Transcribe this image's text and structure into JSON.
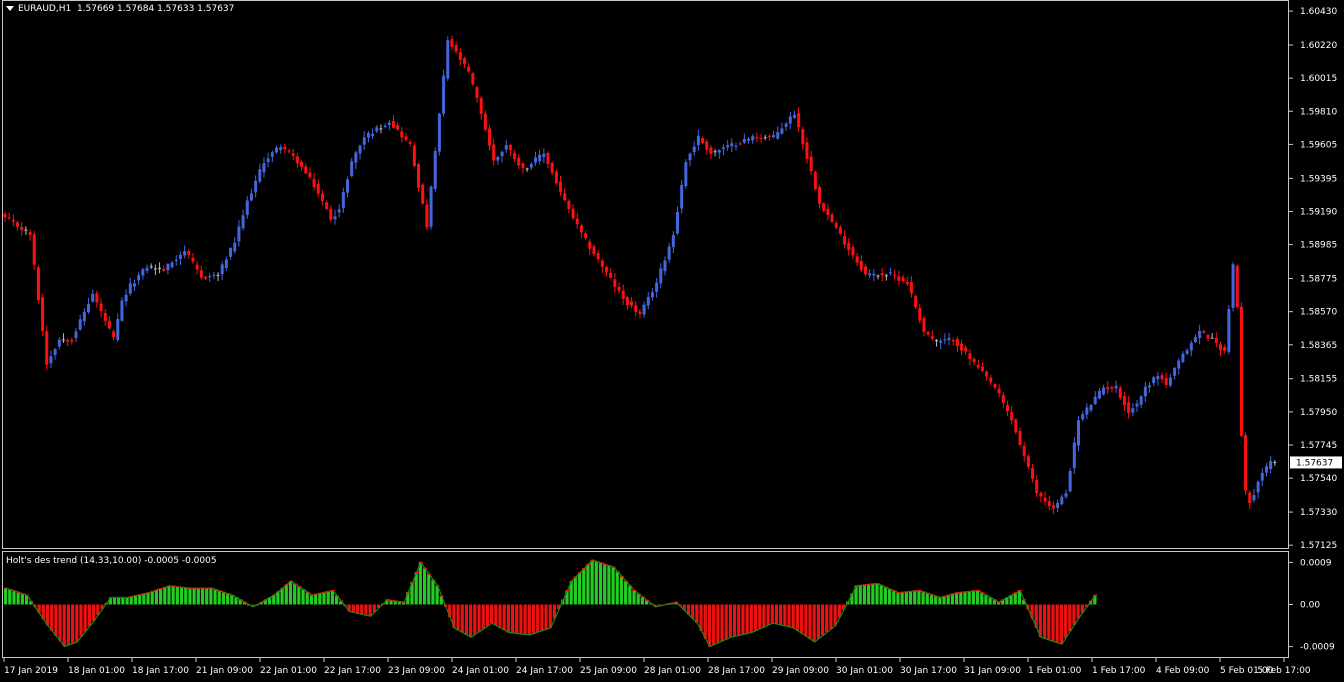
{
  "header": {
    "symbol": "EURAUD,H1",
    "ohlc": "1.57669 1.57684 1.57633 1.57637"
  },
  "indicator": {
    "title": "Holt's des trend (14.33,10.00) -0.0005 -0.0005"
  },
  "colors": {
    "background": "#000000",
    "bull": "#4466dd",
    "bear": "#ff1010",
    "neutral": "#bbbbbb",
    "hist_up": "#22cc22",
    "hist_down": "#ee1111",
    "axis": "#c8c8c8"
  },
  "chart_data": [
    {
      "type": "candlestick",
      "title": "EURAUD,H1",
      "y_ticks": [
        "1.60430",
        "1.60220",
        "1.60015",
        "1.59810",
        "1.59605",
        "1.59395",
        "1.59190",
        "1.58985",
        "1.58775",
        "1.58570",
        "1.58365",
        "1.58155",
        "1.57950",
        "1.57745",
        "1.57540",
        "1.57330",
        "1.57125"
      ],
      "ylim": [
        1.5712,
        1.6048
      ],
      "current_price": "1.57637",
      "x_ticks": [
        "17 Jan 2019",
        "18 Jan 01:00",
        "18 Jan 17:00",
        "21 Jan 09:00",
        "22 Jan 01:00",
        "22 Jan 17:00",
        "23 Jan 09:00",
        "24 Jan 01:00",
        "24 Jan 17:00",
        "25 Jan 09:00",
        "28 Jan 01:00",
        "28 Jan 17:00",
        "29 Jan 09:00",
        "30 Jan 01:00",
        "30 Jan 17:00",
        "31 Jan 09:00",
        "1 Feb 01:00",
        "1 Feb 17:00",
        "4 Feb 09:00",
        "5 Feb 01:00",
        "5 Feb 17:00"
      ],
      "close_path": {
        "index": [
          0,
          6,
          10,
          13,
          16,
          21,
          26,
          28,
          30,
          34,
          38,
          43,
          47,
          51,
          55,
          58,
          62,
          66,
          70,
          74,
          78,
          80,
          83,
          86,
          92,
          97,
          101,
          106,
          111,
          114,
          117,
          120,
          124,
          129,
          134,
          138,
          143,
          148,
          152,
          156,
          160,
          163,
          166,
          169,
          174,
          179,
          184,
          189,
          195,
          201,
          206,
          209,
          212,
          216,
          220,
          223,
          227,
          232,
          237,
          241,
          247,
          251,
          254,
          257,
          260,
          263,
          266,
          269,
          271,
          273,
          276,
          278,
          282,
          286,
          289,
          292
        ],
        "close": [
          1.5915,
          1.5905,
          1.5825,
          1.584,
          1.584,
          1.5868,
          1.584,
          1.5863,
          1.5873,
          1.5885,
          1.5883,
          1.5895,
          1.5878,
          1.588,
          1.59,
          1.5925,
          1.595,
          1.596,
          1.595,
          1.5935,
          1.5915,
          1.592,
          1.595,
          1.5965,
          1.5975,
          1.596,
          1.591,
          1.6025,
          1.6005,
          1.598,
          1.595,
          1.596,
          1.5945,
          1.5955,
          1.5925,
          1.5905,
          1.5885,
          1.5865,
          1.5855,
          1.5875,
          1.5905,
          1.595,
          1.5965,
          1.5955,
          1.596,
          1.5965,
          1.5965,
          1.598,
          1.5925,
          1.59,
          1.588,
          1.588,
          1.588,
          1.5875,
          1.5845,
          1.5838,
          1.584,
          1.5825,
          1.581,
          1.579,
          1.5745,
          1.5735,
          1.5745,
          1.579,
          1.58,
          1.581,
          1.581,
          1.5795,
          1.58,
          1.581,
          1.5818,
          1.5812,
          1.583,
          1.5845,
          1.584,
          1.5832
        ]
      },
      "tail_close": [
        1.586,
        1.5885,
        1.586,
        1.578,
        1.5745,
        1.574,
        1.5745,
        1.5752,
        1.5758,
        1.576,
        1.5764,
        1.5763
      ]
    },
    {
      "type": "bar",
      "title": "Holt's des trend (14.33,10.00)",
      "y_ticks": [
        "0.0009",
        "0.00",
        "-0.0009"
      ],
      "ylim": [
        -0.00108,
        0.00108
      ],
      "series_path": {
        "index": [
          0,
          5,
          10,
          14,
          17,
          21,
          25,
          29,
          34,
          39,
          44,
          49,
          54,
          59,
          64,
          68,
          73,
          78,
          82,
          87,
          91,
          95,
          99,
          103,
          107,
          111,
          116,
          120,
          125,
          130,
          135,
          140,
          145,
          150,
          155,
          160,
          165,
          168,
          173,
          178,
          183,
          188,
          193,
          198,
          203,
          208,
          213,
          218,
          223,
          227,
          232,
          237,
          242,
          247,
          252,
          256,
          260,
          264,
          268,
          272,
          276,
          280,
          283,
          286,
          289,
          292,
          296,
          299,
          302,
          305
        ],
        "value": [
          0.00035,
          0.0002,
          -0.00045,
          -0.0009,
          -0.0008,
          -0.00035,
          0.00015,
          0.00015,
          0.00025,
          0.0004,
          0.00035,
          0.00035,
          0.0002,
          -5e-05,
          0.0002,
          0.0005,
          0.0002,
          0.0003,
          -0.00015,
          -0.00025,
          0.0001,
          5e-05,
          0.0009,
          0.0004,
          -0.0005,
          -0.0007,
          -0.0004,
          -0.0006,
          -0.00065,
          -0.0005,
          0.0005,
          0.00095,
          0.0008,
          0.0003,
          -5e-05,
          5e-05,
          -0.0004,
          -0.0009,
          -0.0007,
          -0.0006,
          -0.0004,
          -0.0005,
          -0.0008,
          -0.00045,
          0.0004,
          0.00045,
          0.00025,
          0.0003,
          0.00015,
          0.00025,
          0.0003,
          5e-05,
          0.0003,
          -0.0007,
          -0.00085,
          -0.0003,
          0.0002
        ]
      }
    }
  ]
}
